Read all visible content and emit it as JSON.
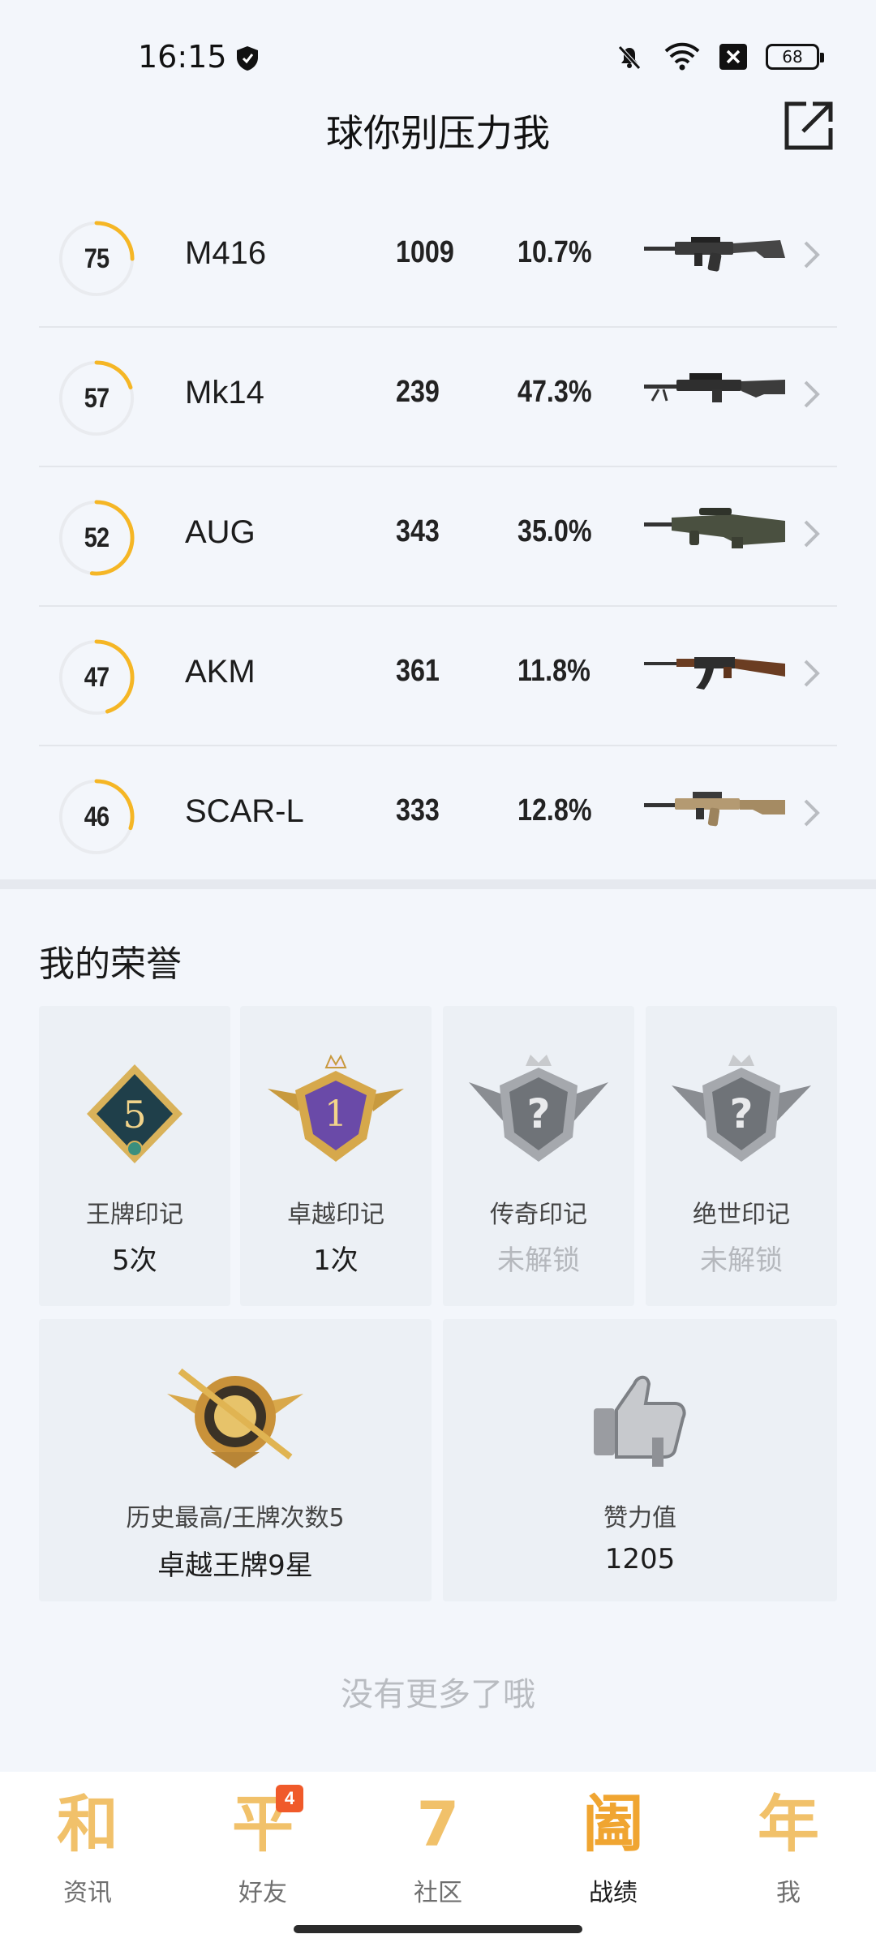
{
  "status": {
    "time": "16:15",
    "battery": "68"
  },
  "header": {
    "title": "球你别压力我"
  },
  "weapons": [
    {
      "score": "75",
      "name": "M416",
      "count": "1009",
      "percent": "10.7%",
      "progress": 0.25
    },
    {
      "score": "57",
      "name": "Mk14",
      "count": "239",
      "percent": "47.3%",
      "progress": 0.2
    },
    {
      "score": "52",
      "name": "AUG",
      "count": "343",
      "percent": "35.0%",
      "progress": 0.52
    },
    {
      "score": "47",
      "name": "AKM",
      "count": "361",
      "percent": "11.8%",
      "progress": 0.45
    },
    {
      "score": "46",
      "name": "SCAR-L",
      "count": "333",
      "percent": "12.8%",
      "progress": 0.3
    }
  ],
  "honors": {
    "title": "我的荣誉",
    "items": [
      {
        "label": "王牌印记",
        "value": "5次",
        "badge_text": "5",
        "locked": false
      },
      {
        "label": "卓越印记",
        "value": "1次",
        "badge_text": "1",
        "locked": false
      },
      {
        "label": "传奇印记",
        "value": "未解锁",
        "locked": true
      },
      {
        "label": "绝世印记",
        "value": "未解锁",
        "locked": true
      }
    ],
    "highest": {
      "label": "历史最高/王牌次数5",
      "value": "卓越王牌9星"
    },
    "likes": {
      "label": "赞力值",
      "value": "1205"
    }
  },
  "footer_note": "没有更多了哦",
  "nav": [
    {
      "glyph": "和",
      "label": "资讯",
      "active": false
    },
    {
      "glyph": "平",
      "label": "好友",
      "active": false,
      "badge": "4"
    },
    {
      "glyph": "7",
      "label": "社区",
      "active": false
    },
    {
      "glyph": "阖",
      "label": "战绩",
      "active": true
    },
    {
      "glyph": "年",
      "label": "我",
      "active": false
    }
  ],
  "colors": {
    "accent": "#f5b625",
    "ring_track": "#e9ebef",
    "background": "#f3f6fb"
  }
}
